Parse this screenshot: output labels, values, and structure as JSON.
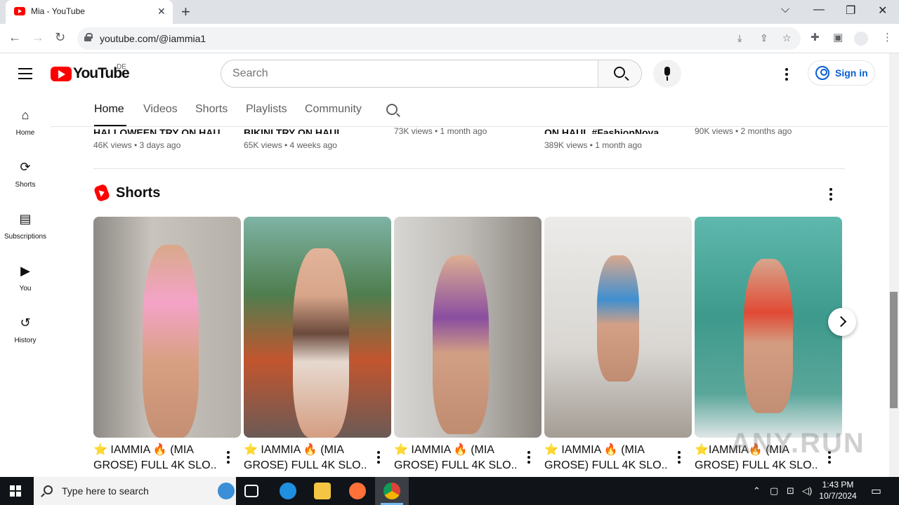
{
  "browser": {
    "tab_title": "Mia - YouTube",
    "url": "youtube.com/@iammia1"
  },
  "header": {
    "logo_text": "YouTube",
    "country_code": "DE",
    "search_placeholder": "Search",
    "signin_label": "Sign in"
  },
  "guide": {
    "items": [
      {
        "label": "Home",
        "icon": "home-icon"
      },
      {
        "label": "Shorts",
        "icon": "shorts-icon"
      },
      {
        "label": "Subscriptions",
        "icon": "subscriptions-icon"
      },
      {
        "label": "You",
        "icon": "you-icon"
      },
      {
        "label": "History",
        "icon": "history-icon"
      }
    ]
  },
  "channel_tabs": [
    "Home",
    "Videos",
    "Shorts",
    "Playlists",
    "Community"
  ],
  "videos": [
    {
      "title": "HALLOWEEN TRY ON HAUL",
      "meta": "46K views • 3 days ago"
    },
    {
      "title": "BIKINI TRY ON HAUL...",
      "meta": "65K views • 4 weeks ago"
    },
    {
      "title": "",
      "meta": "73K views • 1 month ago"
    },
    {
      "title": "ON HAUL #FashionNova",
      "meta": "389K views • 1 month ago"
    },
    {
      "title": "",
      "meta": "90K views • 2 months ago"
    }
  ],
  "shorts_shelf": {
    "title": "Shorts",
    "items": [
      {
        "line1": "⭐ IAMMIA 🔥 (MIA",
        "line2": "GROSE) FULL 4K SLO..."
      },
      {
        "line1": "⭐ IAMMIA 🔥 (MIA",
        "line2": "GROSE) FULL 4K SLO..."
      },
      {
        "line1": "⭐ IAMMIA 🔥 (MIA",
        "line2": "GROSE) FULL 4K SLO..."
      },
      {
        "line1": "⭐ IAMMIA 🔥 (MIA",
        "line2": "GROSE) FULL 4K SLO..."
      },
      {
        "line1": "⭐IAMMIA🔥 (MIA",
        "line2": "GROSE) FULL 4K SLO..."
      }
    ]
  },
  "watermark": "ANY.RUN",
  "taskbar": {
    "search_placeholder": "Type here to search",
    "time": "1:43 PM",
    "date": "10/7/2024"
  }
}
